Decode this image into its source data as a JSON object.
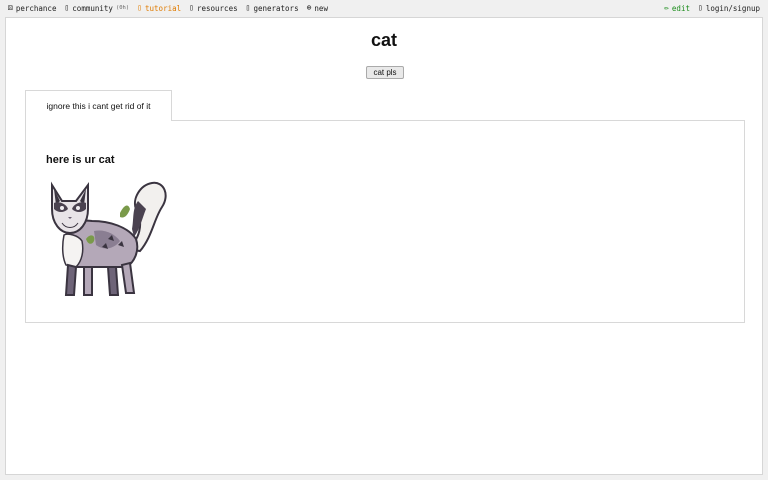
{
  "nav": {
    "left": [
      {
        "id": "perchance",
        "icon": "dice-icon",
        "glyph": "⚄",
        "label": "perchance"
      },
      {
        "id": "community",
        "icon": "chat-icon",
        "glyph": "▯",
        "label": "community",
        "count": "(0h)"
      },
      {
        "id": "tutorial",
        "icon": "book-icon",
        "glyph": "▯",
        "label": "tutorial"
      },
      {
        "id": "resources",
        "icon": "resources-icon",
        "glyph": "▯",
        "label": "resources"
      },
      {
        "id": "generators",
        "icon": "generators-icon",
        "glyph": "▯",
        "label": "generators"
      },
      {
        "id": "new",
        "icon": "plus-circle-icon",
        "glyph": "⊕",
        "label": "new"
      }
    ],
    "right": [
      {
        "id": "edit",
        "icon": "pencil-icon",
        "glyph": "✏",
        "label": "edit"
      },
      {
        "id": "login",
        "icon": "user-icon",
        "glyph": "▯",
        "label": "login/signup"
      }
    ]
  },
  "page": {
    "title": "cat",
    "button_label": "cat pls",
    "tab_label": "ignore this i cant get rid of it",
    "heading": "here is ur cat"
  },
  "colors": {
    "tutorial": "#e07b00",
    "edit": "#1a8c1a",
    "panel_border": "#d8d8d8"
  }
}
